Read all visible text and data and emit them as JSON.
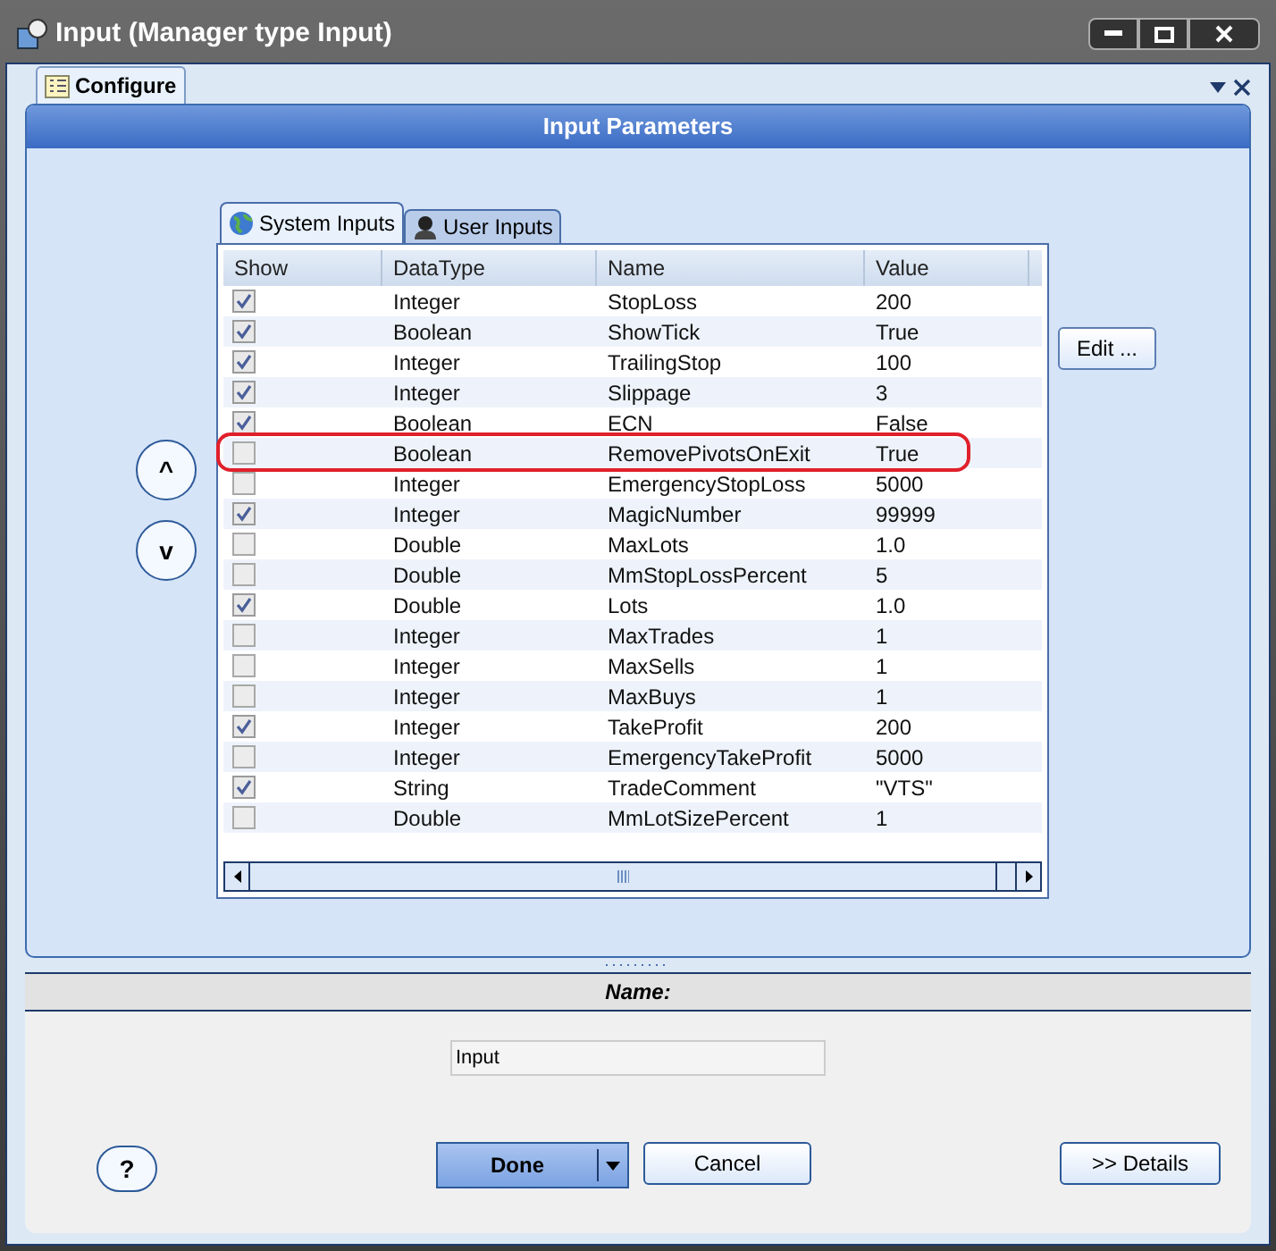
{
  "window": {
    "title": "Input (Manager type Input)"
  },
  "doc_tab": {
    "label": "Configure"
  },
  "panel": {
    "title": "Input Parameters"
  },
  "tabs": [
    {
      "label": "System Inputs",
      "selected": true
    },
    {
      "label": "User Inputs",
      "selected": false
    }
  ],
  "table": {
    "columns": [
      "Show",
      "DataType",
      "Name",
      "Value"
    ],
    "rows": [
      {
        "show": true,
        "type": "Integer",
        "name": "StopLoss",
        "value": "200",
        "highlighted": false
      },
      {
        "show": true,
        "type": "Boolean",
        "name": "ShowTick",
        "value": "True",
        "highlighted": false
      },
      {
        "show": true,
        "type": "Integer",
        "name": "TrailingStop",
        "value": "100",
        "highlighted": false
      },
      {
        "show": true,
        "type": "Integer",
        "name": "Slippage",
        "value": "3",
        "highlighted": false
      },
      {
        "show": true,
        "type": "Boolean",
        "name": "ECN",
        "value": "False",
        "highlighted": false
      },
      {
        "show": false,
        "type": "Boolean",
        "name": "RemovePivotsOnExit",
        "value": "True",
        "highlighted": true
      },
      {
        "show": false,
        "type": "Integer",
        "name": "EmergencyStopLoss",
        "value": "5000",
        "highlighted": false
      },
      {
        "show": true,
        "type": "Integer",
        "name": "MagicNumber",
        "value": "99999",
        "highlighted": false
      },
      {
        "show": false,
        "type": "Double",
        "name": "MaxLots",
        "value": "1.0",
        "highlighted": false
      },
      {
        "show": false,
        "type": "Double",
        "name": "MmStopLossPercent",
        "value": "5",
        "highlighted": false
      },
      {
        "show": true,
        "type": "Double",
        "name": "Lots",
        "value": "1.0",
        "highlighted": false
      },
      {
        "show": false,
        "type": "Integer",
        "name": "MaxTrades",
        "value": "1",
        "highlighted": false
      },
      {
        "show": false,
        "type": "Integer",
        "name": "MaxSells",
        "value": "1",
        "highlighted": false
      },
      {
        "show": false,
        "type": "Integer",
        "name": "MaxBuys",
        "value": "1",
        "highlighted": false
      },
      {
        "show": true,
        "type": "Integer",
        "name": "TakeProfit",
        "value": "200",
        "highlighted": false
      },
      {
        "show": false,
        "type": "Integer",
        "name": "EmergencyTakeProfit",
        "value": "5000",
        "highlighted": false
      },
      {
        "show": true,
        "type": "String",
        "name": "TradeComment",
        "value": "\"VTS\"",
        "highlighted": false
      },
      {
        "show": false,
        "type": "Double",
        "name": "MmLotSizePercent",
        "value": "1",
        "highlighted": false
      }
    ]
  },
  "edit_button": "Edit ...",
  "move_up": "^",
  "move_down": "v",
  "name_section": {
    "title": "Name:",
    "value": "Input"
  },
  "buttons": {
    "help": "?",
    "done": "Done",
    "cancel": "Cancel",
    "details": ">> Details"
  }
}
